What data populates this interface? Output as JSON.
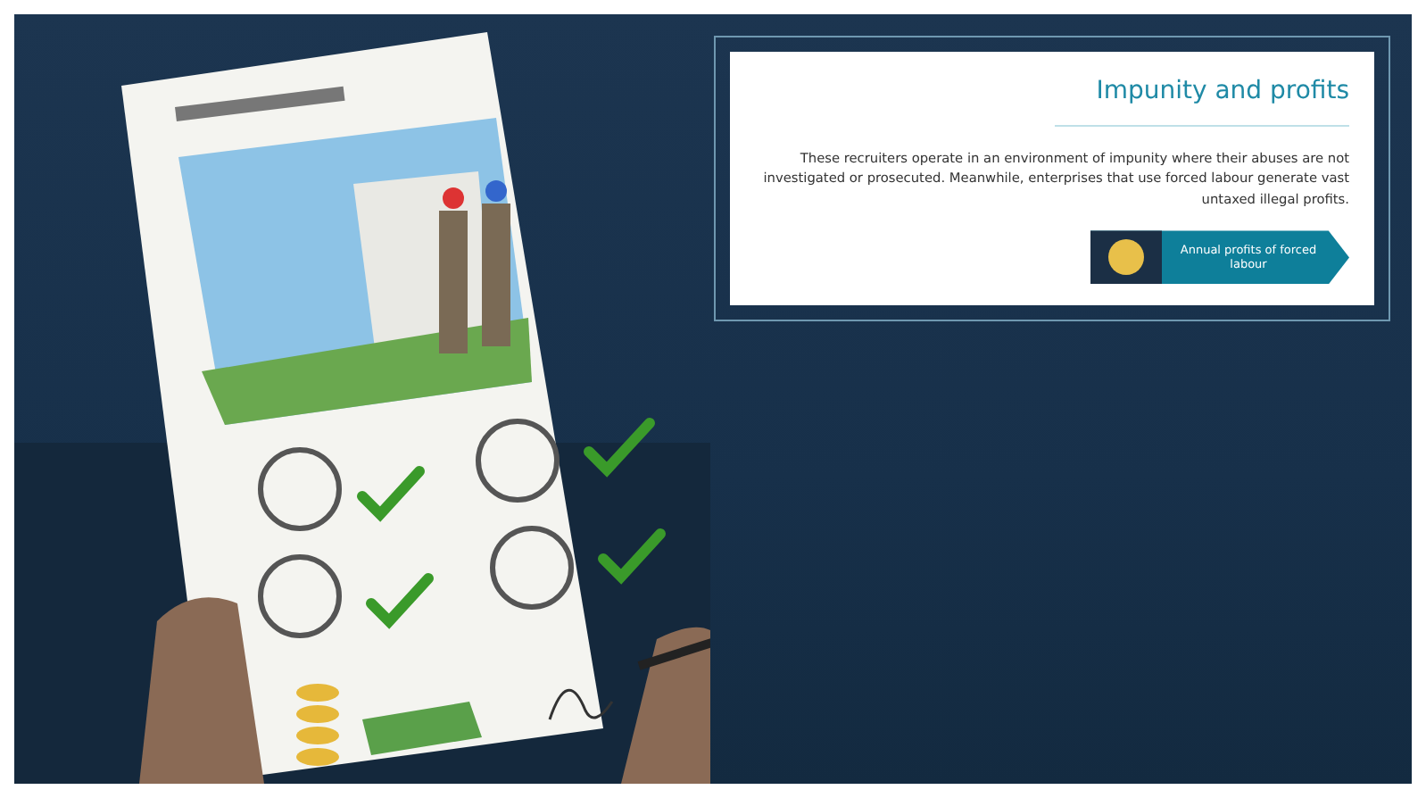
{
  "panel": {
    "title": "Impunity and profits",
    "body": "These recruiters operate in an environment of impunity where their abuses are not investigated or prosecuted. Meanwhile, enterprises that use forced labour generate vast untaxed illegal profits.",
    "link": {
      "label": "Annual profits of forced labour"
    }
  }
}
